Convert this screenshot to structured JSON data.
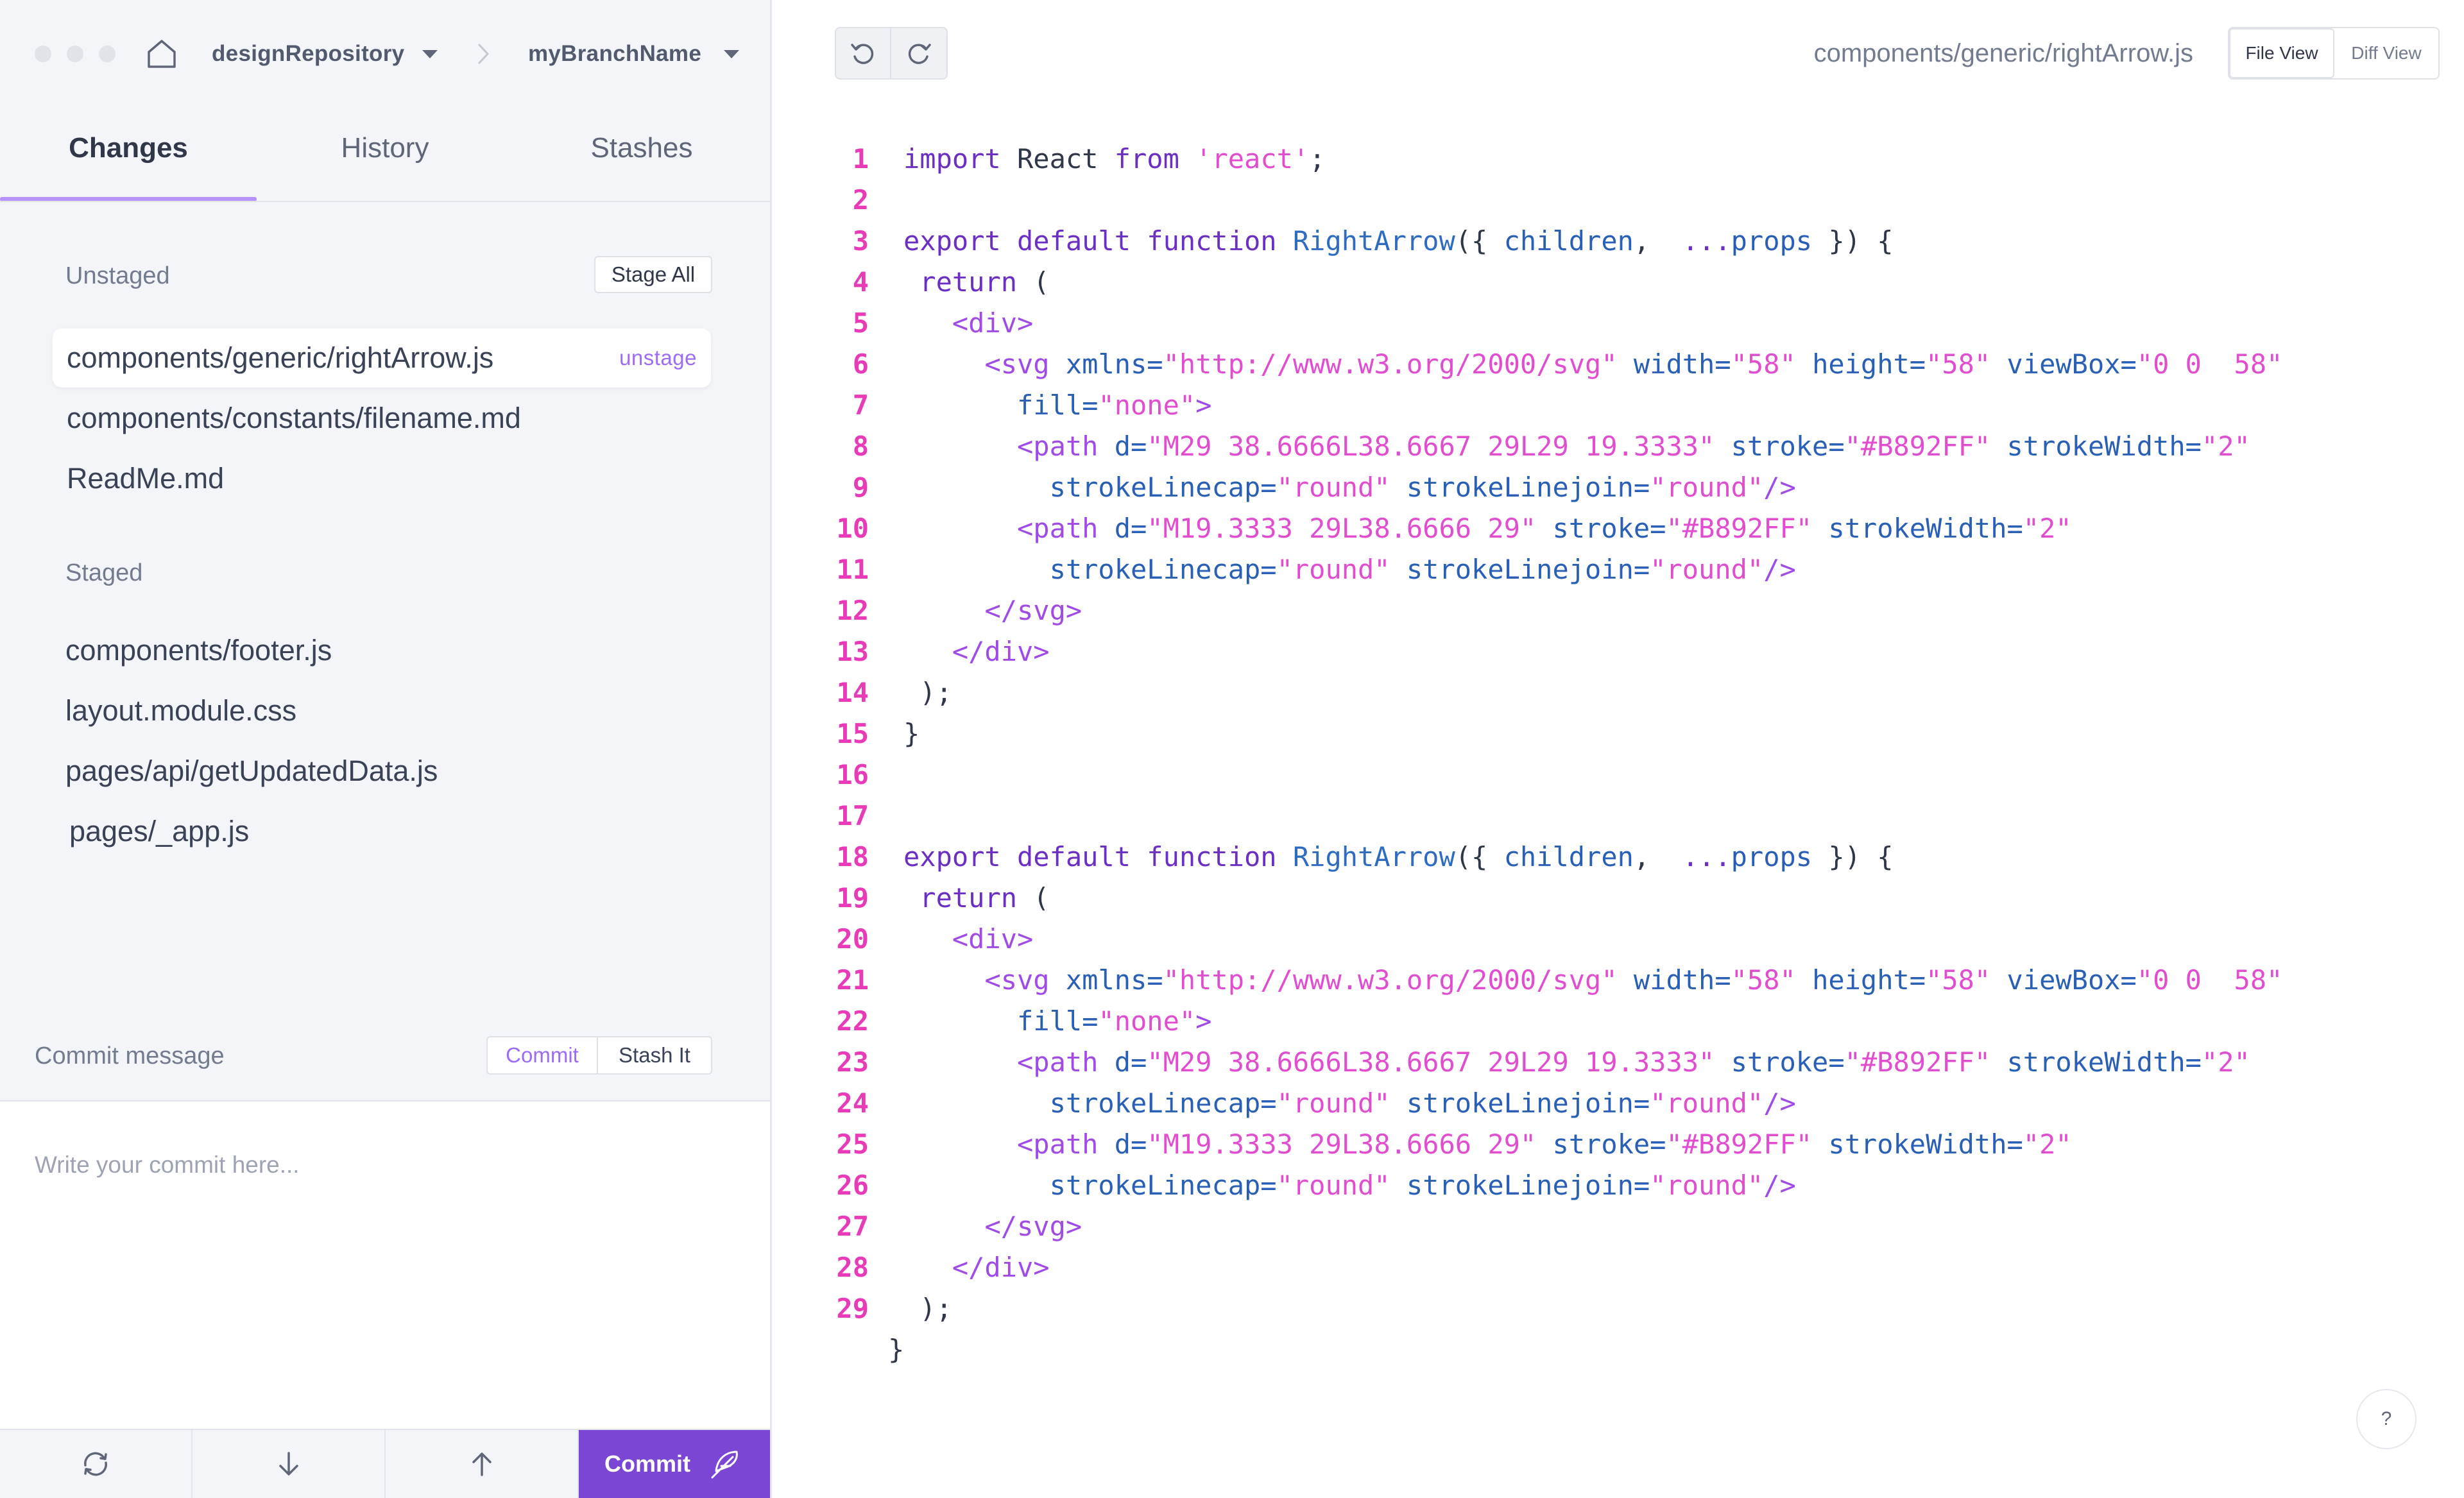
{
  "titlebar": {
    "repository": "designRepository",
    "branch": "myBranchName"
  },
  "tabs": [
    {
      "label": "Changes",
      "active": true
    },
    {
      "label": "History",
      "active": false
    },
    {
      "label": "Stashes",
      "active": false
    }
  ],
  "unstaged": {
    "label": "Unstaged",
    "action": "Stage All",
    "files": [
      {
        "path": "components/generic/rightArrow.js",
        "action": "unstage",
        "selected": true
      },
      {
        "path": "components/constants/filename.md"
      },
      {
        "path": "ReadMe.md"
      }
    ]
  },
  "staged": {
    "label": "Staged",
    "files": [
      {
        "path": "components/footer.js"
      },
      {
        "path": "layout.module.css"
      },
      {
        "path": "pages/api/getUpdatedData.js"
      },
      {
        "path": "pages/_app.js"
      }
    ]
  },
  "commit": {
    "label": "Commit message",
    "commit_tab": "Commit",
    "stash_tab": "Stash It",
    "placeholder": "Write your commit here...",
    "button_label": "Commit"
  },
  "toolbar": {
    "icons": [
      "sync-icon",
      "pull-icon",
      "push-icon",
      "feather-icon"
    ]
  },
  "editor": {
    "file_path": "components/generic/rightArrow.js",
    "file_view_label": "File View",
    "diff_view_label": "Diff View",
    "active_view": "File View",
    "help_label": "?"
  },
  "colors": {
    "accent": "#B892FF",
    "commit_button": "#7B46D4",
    "line_numbers": "#E83BB8",
    "keyword": "#6C2FC4",
    "string": "#E14DCF"
  },
  "code_lines": [
    {
      "n": "1",
      "tokens": [
        [
          "kw",
          "import "
        ],
        [
          "pl",
          "React "
        ],
        [
          "kw",
          "from "
        ],
        [
          "str",
          "'react'"
        ],
        [
          "pl",
          ";"
        ]
      ]
    },
    {
      "n": "2",
      "tokens": []
    },
    {
      "n": "3",
      "tokens": [
        [
          "kw",
          "export default function "
        ],
        [
          "fn",
          "RightArrow"
        ],
        [
          "pl",
          "({ "
        ],
        [
          "attr",
          "children"
        ],
        [
          "pl",
          ",  "
        ],
        [
          "kw",
          "..."
        ],
        [
          "attr",
          "props"
        ],
        [
          "pl",
          " }) {"
        ]
      ]
    },
    {
      "n": "4",
      "tokens": [
        [
          "pl",
          " "
        ],
        [
          "kw",
          "return"
        ],
        [
          "pl",
          " ("
        ]
      ]
    },
    {
      "n": "5",
      "tokens": [
        [
          "pl",
          "   "
        ],
        [
          "tag",
          "<div>"
        ]
      ]
    },
    {
      "n": "6",
      "tokens": [
        [
          "pl",
          "     "
        ],
        [
          "tag",
          "<svg "
        ],
        [
          "attr",
          "xmlns="
        ],
        [
          "str",
          "\"http://www.w3.org/2000/svg\" "
        ],
        [
          "attr",
          "width="
        ],
        [
          "str",
          "\"58\" "
        ],
        [
          "attr",
          "height="
        ],
        [
          "str",
          "\"58\" "
        ],
        [
          "attr",
          "viewBox="
        ],
        [
          "str",
          "\"0 0  58\""
        ]
      ]
    },
    {
      "n": "7",
      "tokens": [
        [
          "pl",
          "       "
        ],
        [
          "attr",
          "fill="
        ],
        [
          "str",
          "\"none\""
        ],
        [
          "tag",
          ">"
        ]
      ]
    },
    {
      "n": "8",
      "tokens": [
        [
          "pl",
          "       "
        ],
        [
          "tag",
          "<path "
        ],
        [
          "attr",
          "d="
        ],
        [
          "str",
          "\"M29 38.6666L38.6667 29L29 19.3333\" "
        ],
        [
          "attr",
          "stroke="
        ],
        [
          "str",
          "\"#B892FF\" "
        ],
        [
          "attr",
          "strokeWidth="
        ],
        [
          "str",
          "\"2\""
        ]
      ]
    },
    {
      "n": "9",
      "tokens": [
        [
          "pl",
          "         "
        ],
        [
          "attr",
          "strokeLinecap="
        ],
        [
          "str",
          "\"round\" "
        ],
        [
          "attr",
          "strokeLinejoin="
        ],
        [
          "str",
          "\"round\""
        ],
        [
          "tag",
          "/>"
        ]
      ]
    },
    {
      "n": "10",
      "tokens": [
        [
          "pl",
          "       "
        ],
        [
          "tag",
          "<path "
        ],
        [
          "attr",
          "d="
        ],
        [
          "str",
          "\"M19.3333 29L38.6666 29\" "
        ],
        [
          "attr",
          "stroke="
        ],
        [
          "str",
          "\"#B892FF\" "
        ],
        [
          "attr",
          "strokeWidth="
        ],
        [
          "str",
          "\"2\""
        ]
      ]
    },
    {
      "n": "11",
      "tokens": [
        [
          "pl",
          "         "
        ],
        [
          "attr",
          "strokeLinecap="
        ],
        [
          "str",
          "\"round\" "
        ],
        [
          "attr",
          "strokeLinejoin="
        ],
        [
          "str",
          "\"round\""
        ],
        [
          "tag",
          "/>"
        ]
      ]
    },
    {
      "n": "12",
      "tokens": [
        [
          "pl",
          "     "
        ],
        [
          "tag",
          "</svg>"
        ]
      ]
    },
    {
      "n": "13",
      "tokens": [
        [
          "pl",
          "   "
        ],
        [
          "tag",
          "</div>"
        ]
      ]
    },
    {
      "n": "14",
      "tokens": [
        [
          "pl",
          " );"
        ]
      ]
    },
    {
      "n": "15",
      "tokens": [
        [
          "pl",
          "}"
        ]
      ]
    },
    {
      "n": "16",
      "tokens": []
    },
    {
      "n": "17",
      "tokens": []
    },
    {
      "n": "18",
      "tokens": [
        [
          "kw",
          "export default function "
        ],
        [
          "fn",
          "RightArrow"
        ],
        [
          "pl",
          "({ "
        ],
        [
          "attr",
          "children"
        ],
        [
          "pl",
          ",  "
        ],
        [
          "kw",
          "..."
        ],
        [
          "attr",
          "props"
        ],
        [
          "pl",
          " }) {"
        ]
      ]
    },
    {
      "n": "19",
      "tokens": [
        [
          "pl",
          " "
        ],
        [
          "kw",
          "return"
        ],
        [
          "pl",
          " ("
        ]
      ]
    },
    {
      "n": "20",
      "tokens": [
        [
          "pl",
          "   "
        ],
        [
          "tag",
          "<div>"
        ]
      ]
    },
    {
      "n": "21",
      "tokens": [
        [
          "pl",
          "     "
        ],
        [
          "tag",
          "<svg "
        ],
        [
          "attr",
          "xmlns="
        ],
        [
          "str",
          "\"http://www.w3.org/2000/svg\" "
        ],
        [
          "attr",
          "width="
        ],
        [
          "str",
          "\"58\" "
        ],
        [
          "attr",
          "height="
        ],
        [
          "str",
          "\"58\" "
        ],
        [
          "attr",
          "viewBox="
        ],
        [
          "str",
          "\"0 0  58\""
        ]
      ]
    },
    {
      "n": "22",
      "tokens": [
        [
          "pl",
          "       "
        ],
        [
          "attr",
          "fill="
        ],
        [
          "str",
          "\"none\""
        ],
        [
          "tag",
          ">"
        ]
      ]
    },
    {
      "n": "23",
      "tokens": [
        [
          "pl",
          "       "
        ],
        [
          "tag",
          "<path "
        ],
        [
          "attr",
          "d="
        ],
        [
          "str",
          "\"M29 38.6666L38.6667 29L29 19.3333\" "
        ],
        [
          "attr",
          "stroke="
        ],
        [
          "str",
          "\"#B892FF\" "
        ],
        [
          "attr",
          "strokeWidth="
        ],
        [
          "str",
          "\"2\""
        ]
      ]
    },
    {
      "n": "24",
      "tokens": [
        [
          "pl",
          "         "
        ],
        [
          "attr",
          "strokeLinecap="
        ],
        [
          "str",
          "\"round\" "
        ],
        [
          "attr",
          "strokeLinejoin="
        ],
        [
          "str",
          "\"round\""
        ],
        [
          "tag",
          "/>"
        ]
      ]
    },
    {
      "n": "25",
      "tokens": [
        [
          "pl",
          "       "
        ],
        [
          "tag",
          "<path "
        ],
        [
          "attr",
          "d="
        ],
        [
          "str",
          "\"M19.3333 29L38.6666 29\" "
        ],
        [
          "attr",
          "stroke="
        ],
        [
          "str",
          "\"#B892FF\" "
        ],
        [
          "attr",
          "strokeWidth="
        ],
        [
          "str",
          "\"2\""
        ]
      ]
    },
    {
      "n": "26",
      "tokens": [
        [
          "pl",
          "         "
        ],
        [
          "attr",
          "strokeLinecap="
        ],
        [
          "str",
          "\"round\" "
        ],
        [
          "attr",
          "strokeLinejoin="
        ],
        [
          "str",
          "\"round\""
        ],
        [
          "tag",
          "/>"
        ]
      ]
    },
    {
      "n": "27",
      "tokens": [
        [
          "pl",
          "     "
        ],
        [
          "tag",
          "</svg>"
        ]
      ]
    },
    {
      "n": "28",
      "tokens": [
        [
          "pl",
          "   "
        ],
        [
          "tag",
          "</div>"
        ]
      ]
    },
    {
      "n": "29",
      "tokens": [
        [
          "pl",
          " );"
        ]
      ]
    },
    {
      "n": "",
      "tokens": [
        [
          "pl",
          "}"
        ]
      ]
    }
  ]
}
